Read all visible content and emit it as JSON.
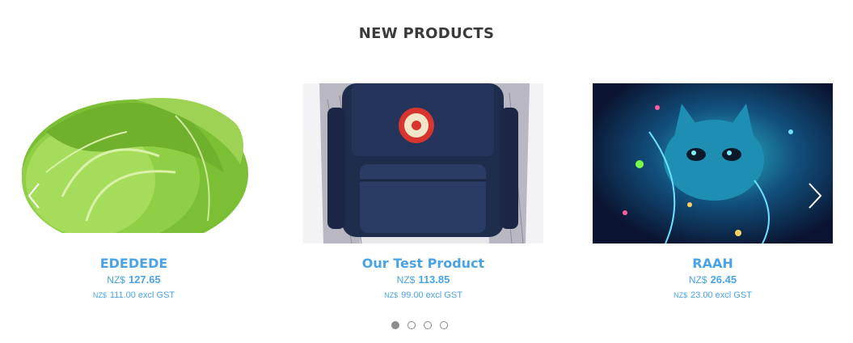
{
  "section": {
    "title": "NEW PRODUCTS"
  },
  "products": [
    {
      "name": "EDEDEDE",
      "currency": "NZ$",
      "price": "127.65",
      "excl_currency": "NZ$",
      "excl_price": "111.00 excl GST",
      "image": "cabbage"
    },
    {
      "name": "Our Test Product",
      "currency": "NZ$",
      "price": "113.85",
      "excl_currency": "NZ$",
      "excl_price": "99.00 excl GST",
      "image": "backpack"
    },
    {
      "name": "RAAH",
      "currency": "NZ$",
      "price": "26.45",
      "excl_currency": "NZ$",
      "excl_price": "23.00 excl GST",
      "image": "kitten-with-lights"
    }
  ],
  "carousel": {
    "prev_icon": "chevron-left-icon",
    "next_icon": "chevron-right-icon",
    "page_count": 4,
    "active_page": 1
  },
  "colors": {
    "accent": "#4aa3e6",
    "title": "#3a3a3a",
    "dot_active": "#8c8c8c"
  }
}
